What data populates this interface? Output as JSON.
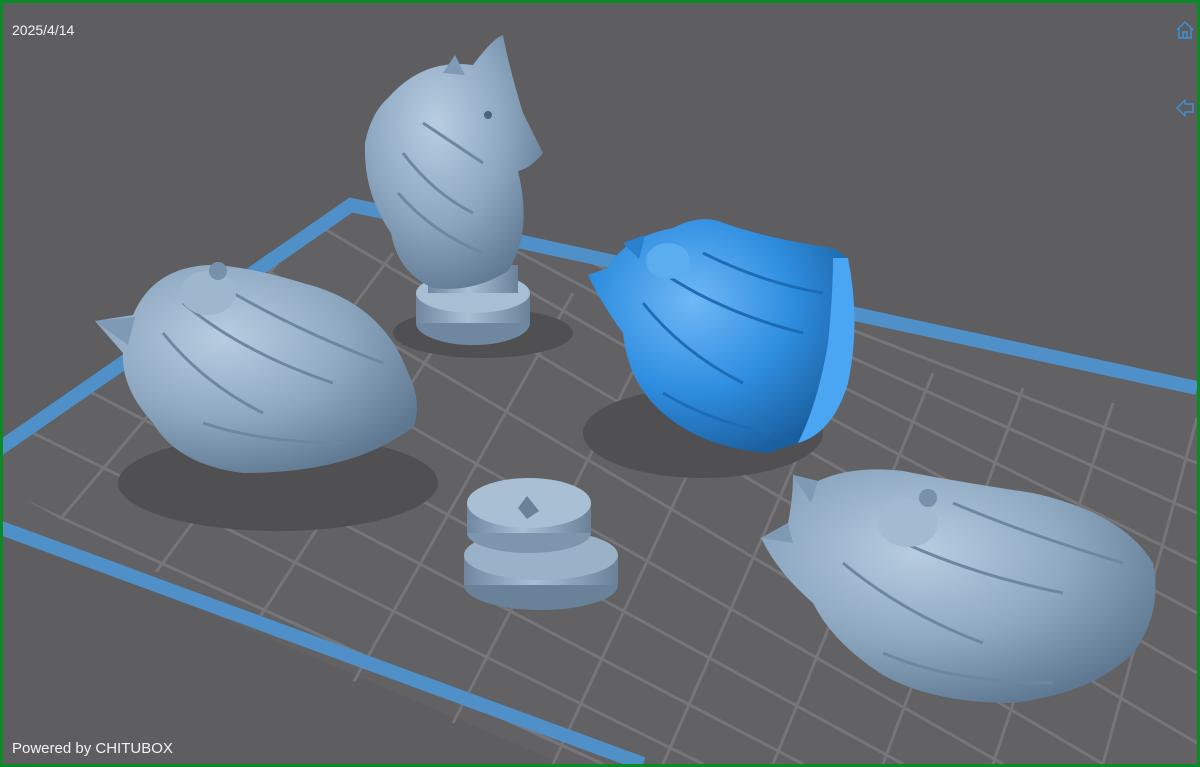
{
  "viewer": {
    "date": "2025/4/14",
    "powered_by": "Powered by CHITUBOX",
    "colors": {
      "background": "#5e5e61",
      "build_plate_border": "#4f90c8",
      "grid_lines": "#747477",
      "model": "#8fa9c4",
      "model_selected": "#2f8ee0",
      "window_border": "#0c8a25"
    },
    "icons": [
      "home-icon",
      "back-arrow-icon"
    ]
  },
  "models": [
    {
      "name": "lying-dog-left"
    },
    {
      "name": "dog-bust-on-pedestal"
    },
    {
      "name": "dog-head-selected"
    },
    {
      "name": "round-base"
    },
    {
      "name": "lying-dog-right"
    }
  ]
}
